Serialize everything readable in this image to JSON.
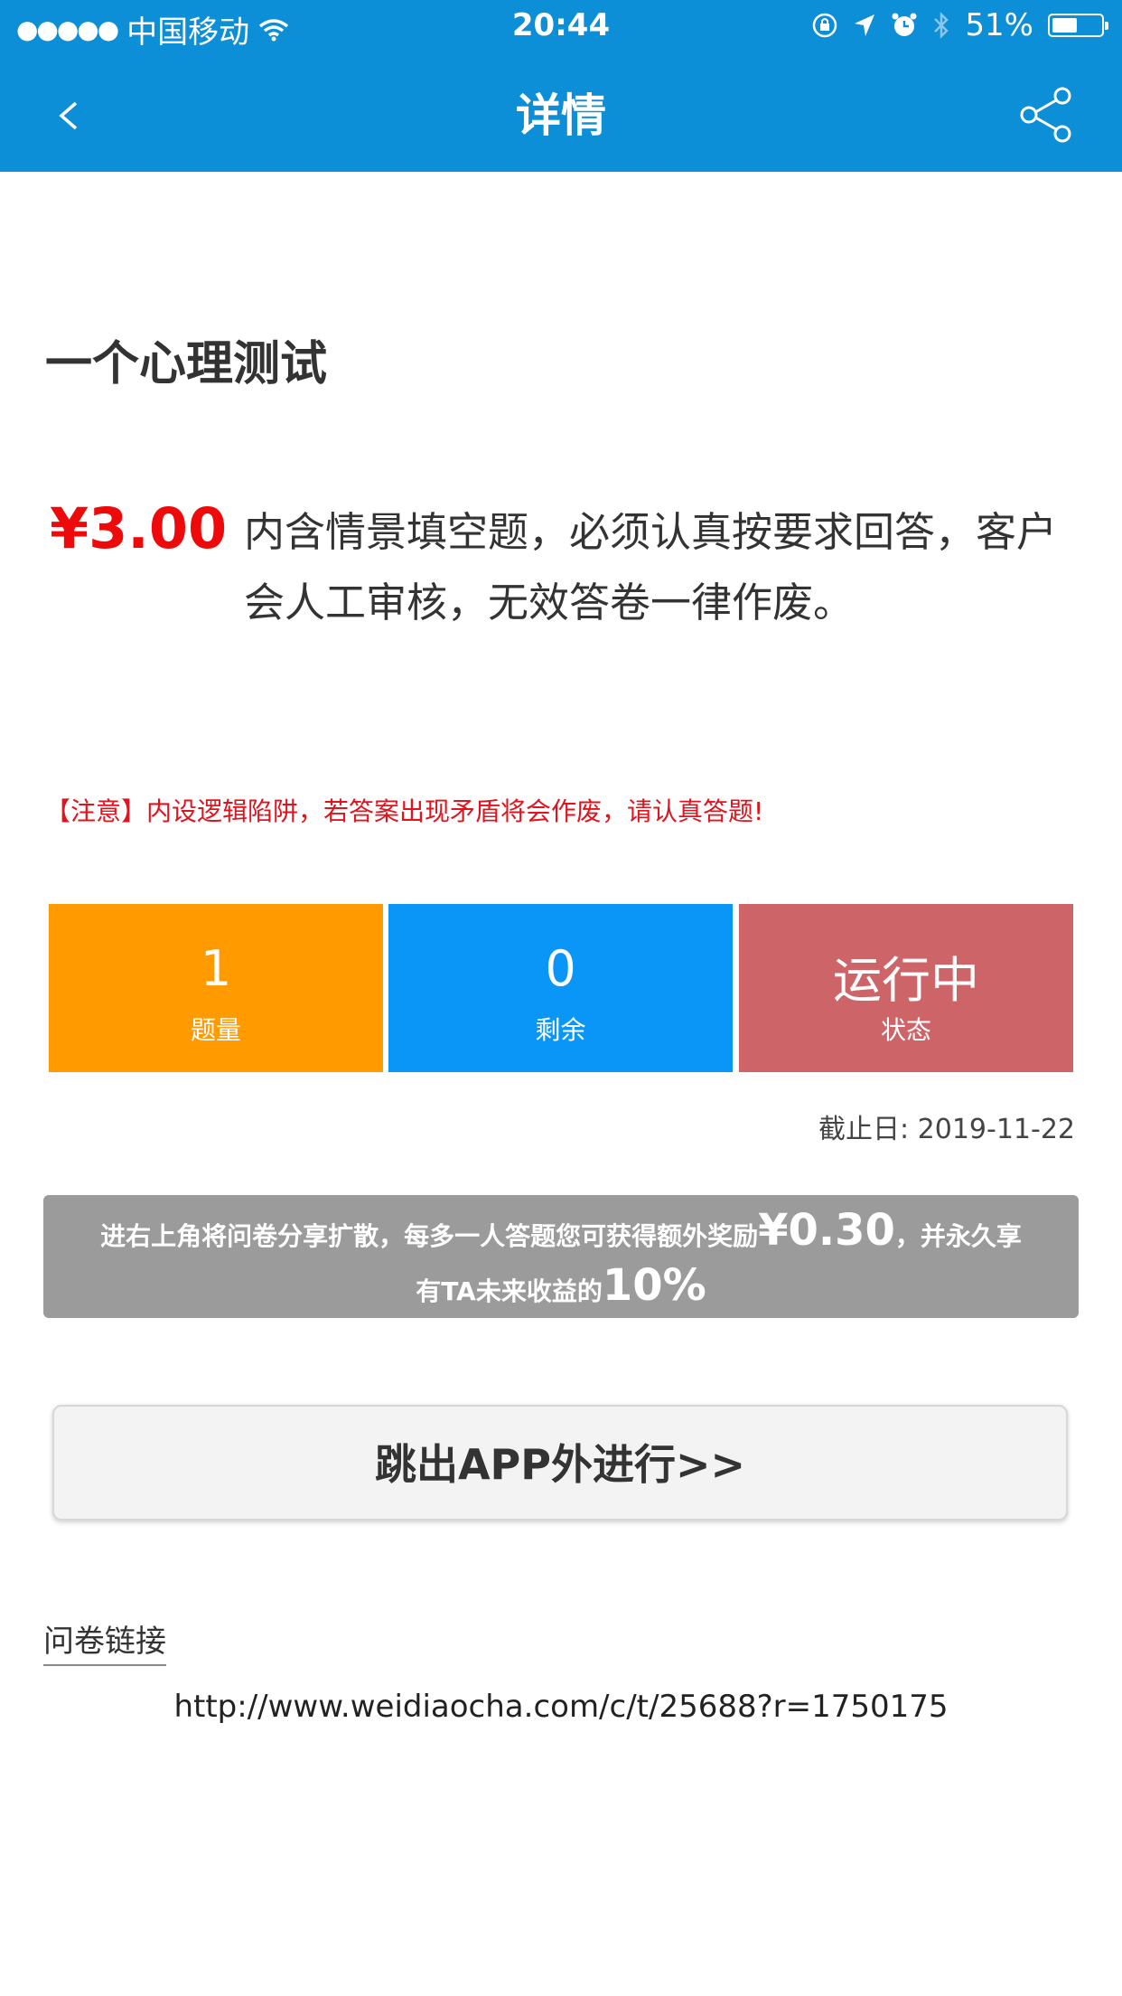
{
  "status_bar": {
    "signal_dots": "●●●●●",
    "carrier": "中国移动",
    "time": "20:44",
    "battery_percent": "51%",
    "battery_level": 0.51,
    "icons": [
      "wifi-icon",
      "orientation-lock-icon",
      "location-icon",
      "alarm-icon",
      "bluetooth-icon",
      "battery-icon"
    ]
  },
  "nav": {
    "title": "详情",
    "back_icon": "chevron-left-icon",
    "share_icon": "share-icon"
  },
  "survey": {
    "title": "一个心理测试",
    "price": "¥3.00",
    "description": "内含情景填空题，必须认真按要求回答，客户会人工审核，无效答卷一律作废。",
    "notice": "【注意】内设逻辑陷阱，若答案出现矛盾将会作废，请认真答题!"
  },
  "stats": [
    {
      "value": "1",
      "label": "题量",
      "color": "#ff9a00"
    },
    {
      "value": "0",
      "label": "剩余",
      "color": "#0a96f6"
    },
    {
      "value": "运行中",
      "label": "状态",
      "color": "#cd6467"
    }
  ],
  "deadline": "截止日: 2019-11-22",
  "promo": {
    "line1_prefix": "进右上角将问卷分享扩散，每多一人答题您可获得额外奖励",
    "reward": "¥0.30",
    "line1_suffix": "，并永久享",
    "line2_prefix": "有TA未来收益的",
    "percent": "10%"
  },
  "jump_button": "跳出APP外进行>>",
  "link": {
    "label": "问卷链接",
    "url": "http://www.weidiaocha.com/c/t/25688?r=1750175"
  },
  "colors": {
    "header_blue": "#0c8fd6",
    "price_red": "#ee0a0a",
    "promo_gray": "#9b9b9b"
  }
}
